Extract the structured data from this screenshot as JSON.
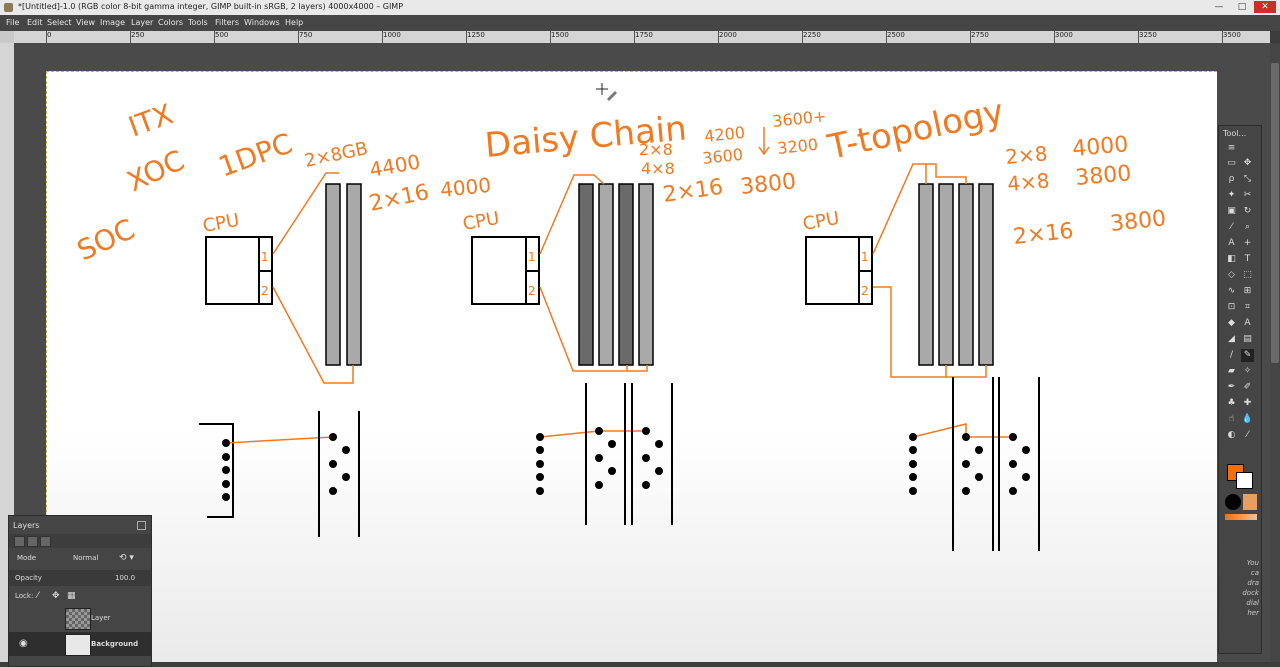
{
  "window": {
    "title": "*[Untitled]-1.0 (RGB color 8-bit gamma integer, GIMP built-in sRGB, 2 layers) 4000x4000 – GIMP",
    "minimize": "—",
    "maximize": "□",
    "close": "✕"
  },
  "menu": [
    "File",
    "Edit",
    "Select",
    "View",
    "Image",
    "Layer",
    "Colors",
    "Tools",
    "Filters",
    "Windows",
    "Help"
  ],
  "ruler": {
    "top_labels": [
      "0",
      "250",
      "500",
      "750",
      "1000",
      "1250",
      "1500",
      "1750",
      "2000",
      "2250",
      "2500",
      "2750",
      "3000",
      "3250",
      "3500"
    ]
  },
  "drawing": {
    "itx": "ITX",
    "xoc": "XOC",
    "dpc": "1DPC",
    "soc": "SOC",
    "daisy": "Daisy Chain",
    "ttopo": "T-topology",
    "cpu": "CPU",
    "ch1": "1",
    "ch2": "2",
    "g1_mem": "2×8GB",
    "g1_4400": "4400",
    "g1_2x16": "2×16",
    "g1_4000": "4000",
    "g2_2x8": "2×8",
    "g2_4x8": "4×8",
    "g2_4200": "4200",
    "g2_3600": "3600",
    "g2_3600p": "3600+",
    "g2_3200": "3200",
    "g2_2x16": "2×16",
    "g2_3800": "3800",
    "g3_2x8": "2×8",
    "g3_4000": "4000",
    "g3_4x8": "4×8",
    "g3_3800": "3800",
    "g3_2x16": "2×16",
    "g3_3800b": "3800",
    "accent": "#ef7a22"
  },
  "layers_panel": {
    "title": "Layers",
    "mode_label": "Mode",
    "mode_value": "Normal",
    "opacity_label": "Opacity",
    "opacity_value": "100.0",
    "lock_label": "Lock:",
    "layers": [
      {
        "name": "Layer"
      },
      {
        "name": "Background"
      }
    ]
  },
  "toolbox": {
    "title": "Tool...",
    "tooltip_lines": [
      "You",
      "ca",
      "dra",
      "dock",
      "dial",
      "her"
    ],
    "fg_color": "#f07010",
    "bg_color": "#ffffff"
  }
}
